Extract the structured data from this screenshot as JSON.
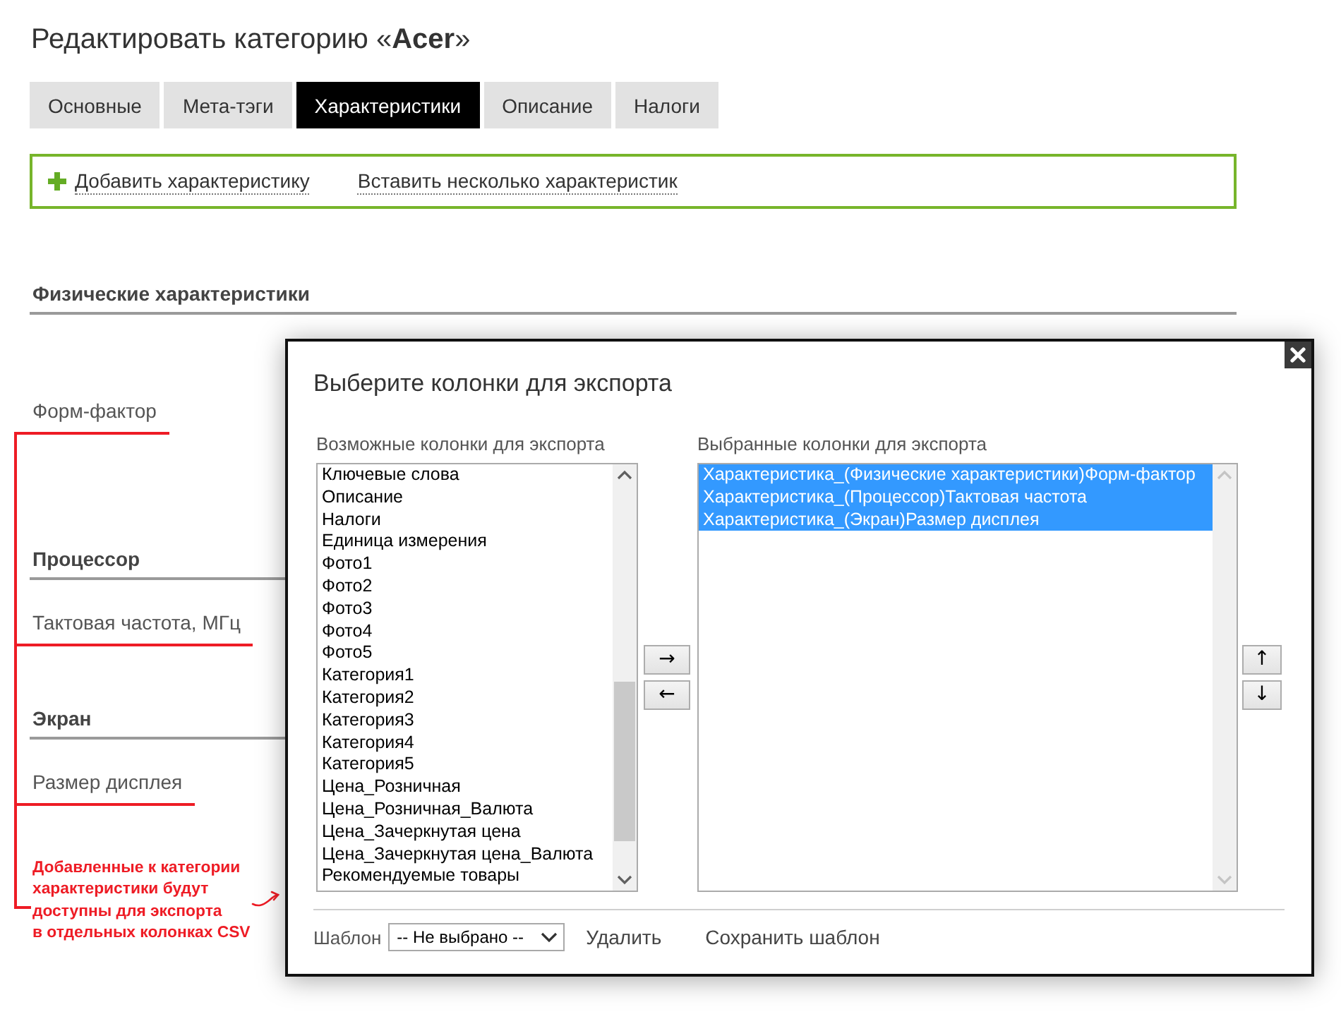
{
  "page": {
    "title": "Редактировать категорию «**Acer**»"
  },
  "tabs": [
    {
      "label": "Основные",
      "selected": false
    },
    {
      "label": "Мета-тэги",
      "selected": false
    },
    {
      "label": "Характеристики",
      "selected": true
    },
    {
      "label": "Описание",
      "selected": false
    },
    {
      "label": "Налоги",
      "selected": false
    }
  ],
  "actions": [
    {
      "kind": "add",
      "label": "Добавить характеристику"
    },
    {
      "kind": "plain",
      "label": "Вставить несколько характеристик"
    }
  ],
  "groups": [
    {
      "title": "Физические характеристики",
      "features": [
        {
          "name": "Форм-фактор",
          "marked": true
        }
      ]
    },
    {
      "title": "Процессор",
      "features": [
        {
          "name": "Тактовая частота, МГц",
          "marked": true
        }
      ]
    },
    {
      "title": "Экран",
      "features": [
        {
          "name": "Размер дисплея",
          "marked": true
        }
      ]
    }
  ],
  "annotation": {
    "note": "Добавленные к категории\nхарактеристики будут\nдоступны для экспорта\nв отдельных колонках CSV"
  },
  "dialog": {
    "title": "Выберите колонки для экспорта",
    "available": {
      "label": "Возможные колонки для экспорта",
      "items": [
        {
          "label": "Ключевые слова",
          "selected": false
        },
        {
          "label": "Описание",
          "selected": false
        },
        {
          "label": "Налоги",
          "selected": false
        },
        {
          "label": "Единица измерения",
          "selected": false
        },
        {
          "label": "Фото1",
          "selected": false
        },
        {
          "label": "Фото2",
          "selected": false
        },
        {
          "label": "Фото3",
          "selected": false
        },
        {
          "label": "Фото4",
          "selected": false
        },
        {
          "label": "Фото5",
          "selected": false
        },
        {
          "label": "Категория1",
          "selected": false
        },
        {
          "label": "Категория2",
          "selected": false
        },
        {
          "label": "Категория3",
          "selected": false
        },
        {
          "label": "Категория4",
          "selected": false
        },
        {
          "label": "Категория5",
          "selected": false
        },
        {
          "label": "Цена_Розничная",
          "selected": false
        },
        {
          "label": "Цена_Розничная_Валюта",
          "selected": false
        },
        {
          "label": "Цена_Зачеркнутая цена",
          "selected": false
        },
        {
          "label": "Цена_Зачеркнутая цена_Валюта",
          "selected": false
        },
        {
          "label": "Рекомендуемые товары",
          "selected": false
        }
      ]
    },
    "chosen": {
      "label": "Выбранные колонки для экспорта",
      "items": [
        {
          "label": "Характеристика_(Физические характеристики)Форм-фактор",
          "selected": true
        },
        {
          "label": "Характеристика_(Процессор)Тактовая частота",
          "selected": true
        },
        {
          "label": "Характеристика_(Экран)Размер дисплея",
          "selected": true
        }
      ]
    },
    "move_buttons": [
      "→",
      "←"
    ],
    "order_buttons": [
      "↑",
      "↓"
    ],
    "template": {
      "label": "Шаблон",
      "value": "-- Не выбрано --"
    },
    "footer_links": [
      "Удалить",
      "Сохранить шаблон"
    ]
  }
}
